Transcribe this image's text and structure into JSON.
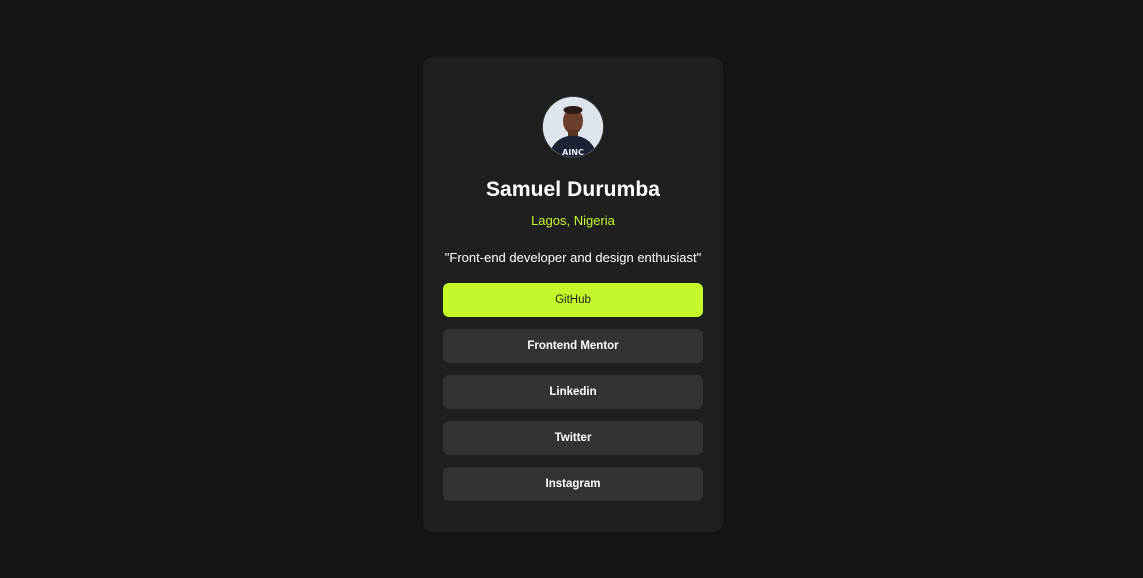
{
  "profile": {
    "name": "Samuel Durumba",
    "location": "Lagos, Nigeria",
    "bio": "\"Front-end developer and design enthusiast\""
  },
  "links": [
    {
      "label": "GitHub",
      "active": true
    },
    {
      "label": "Frontend Mentor",
      "active": false
    },
    {
      "label": "Linkedin",
      "active": false
    },
    {
      "label": "Twitter",
      "active": false
    },
    {
      "label": "Instagram",
      "active": false
    }
  ],
  "colors": {
    "page_background": "#141414",
    "card_background": "#1f1f1f",
    "button_background": "#333333",
    "accent": "#c4f82a",
    "text": "#ffffff"
  }
}
